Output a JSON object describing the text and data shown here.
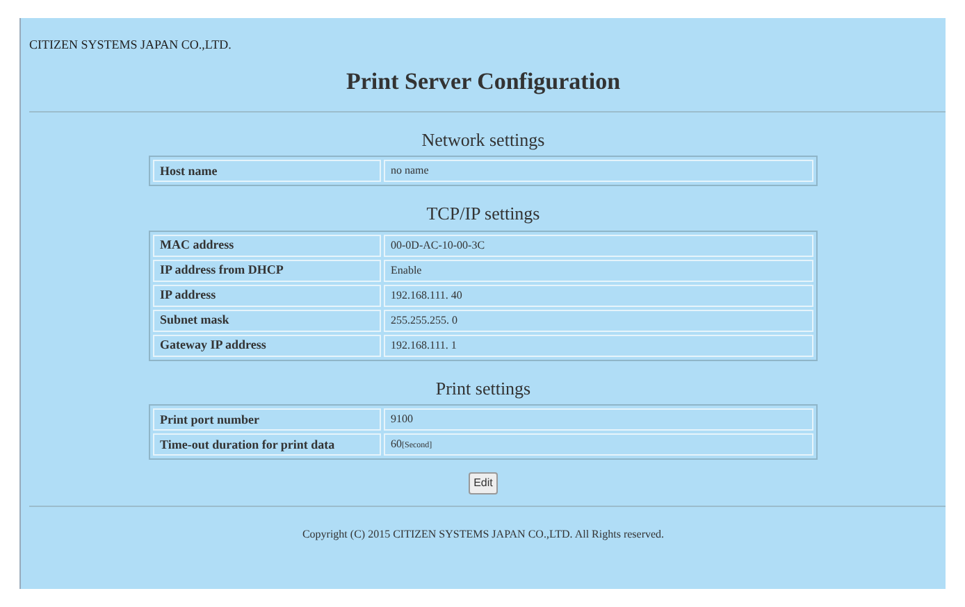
{
  "company": "CITIZEN SYSTEMS JAPAN CO.,LTD.",
  "title": "Print Server Configuration",
  "sections": [
    {
      "heading": "Network settings",
      "rows": [
        {
          "label": "Host name",
          "value": "no name"
        }
      ]
    },
    {
      "heading": "TCP/IP settings",
      "rows": [
        {
          "label": "MAC address",
          "value": "00-0D-AC-10-00-3C"
        },
        {
          "label": "IP address from DHCP",
          "value": "Enable"
        },
        {
          "label": "IP address",
          "value": "192.168.111. 40"
        },
        {
          "label": "Subnet mask",
          "value": "255.255.255. 0"
        },
        {
          "label": "Gateway IP address",
          "value": "192.168.111. 1"
        }
      ]
    },
    {
      "heading": "Print settings",
      "rows": [
        {
          "label": "Print port number",
          "value": "9100"
        },
        {
          "label": "Time-out duration for print data",
          "value": "60",
          "unit": "[Second]"
        }
      ]
    }
  ],
  "button": "Edit",
  "copyright": "Copyright (C) 2015 CITIZEN SYSTEMS JAPAN CO.,LTD. All Rights reserved."
}
